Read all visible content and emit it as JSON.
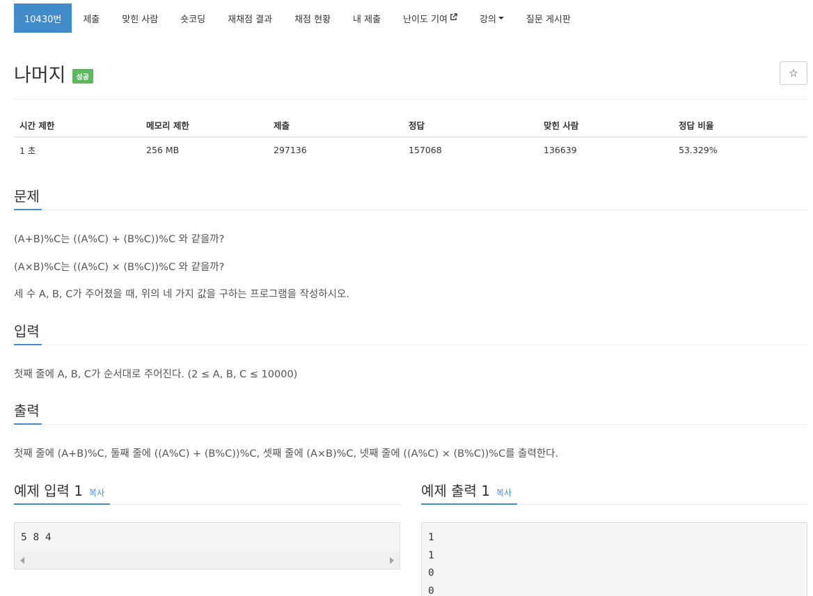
{
  "nav": {
    "items": [
      {
        "label": "10430번",
        "active": true
      },
      {
        "label": "제출"
      },
      {
        "label": "맞힌 사람"
      },
      {
        "label": "숏코딩"
      },
      {
        "label": "재채점 결과"
      },
      {
        "label": "채점 현황"
      },
      {
        "label": "내 제출"
      },
      {
        "label": "난이도 기여",
        "icon": "external-link-icon"
      },
      {
        "label": "강의",
        "icon": "caret-down-icon"
      },
      {
        "label": "질문 게시판"
      }
    ]
  },
  "problem": {
    "title": "나머지",
    "status_badge": "성공",
    "star_glyph": "☆"
  },
  "stats": {
    "headers": [
      "시간 제한",
      "메모리 제한",
      "제출",
      "정답",
      "맞힌 사람",
      "정답 비율"
    ],
    "values": [
      "1 초",
      "256 MB",
      "297136",
      "157068",
      "136639",
      "53.329%"
    ]
  },
  "sections": {
    "description": {
      "heading": "문제",
      "lines": [
        "(A+B)%C는 ((A%C) + (B%C))%C 와 같을까?",
        "(A×B)%C는 ((A%C) × (B%C))%C 와 같을까?",
        "세 수 A, B, C가 주어졌을 때, 위의 네 가지 값을 구하는 프로그램을 작성하시오."
      ]
    },
    "input": {
      "heading": "입력",
      "text": "첫째 줄에 A, B, C가 순서대로 주어진다. (2 ≤ A, B, C ≤ 10000)"
    },
    "output": {
      "heading": "출력",
      "text": "첫째 줄에 (A+B)%C, 둘째 줄에 ((A%C) + (B%C))%C, 셋째 줄에 (A×B)%C, 넷째 줄에 ((A%C) × (B%C))%C를 출력한다."
    }
  },
  "samples": {
    "input": {
      "title": "예제 입력 1",
      "copy_label": "복사",
      "lines": [
        "5 8 4"
      ]
    },
    "output": {
      "title": "예제 출력 1",
      "copy_label": "복사",
      "lines": [
        "1",
        "1",
        "0",
        "0"
      ]
    }
  },
  "colors": {
    "accent": "#428bca",
    "success": "#5cb85c"
  }
}
